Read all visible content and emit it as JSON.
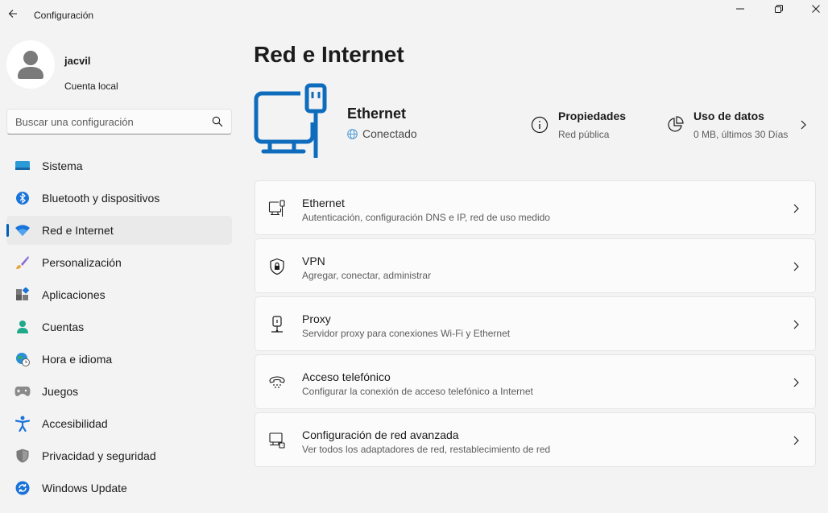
{
  "app": {
    "title": "Configuración"
  },
  "user": {
    "name": "jacvil",
    "account_type": "Cuenta local"
  },
  "search": {
    "placeholder": "Buscar una configuración"
  },
  "sidebar": {
    "items": [
      {
        "label": "Sistema",
        "icon": "system-icon"
      },
      {
        "label": "Bluetooth y dispositivos",
        "icon": "bluetooth-icon"
      },
      {
        "label": "Red e Internet",
        "icon": "wifi-icon",
        "active": true
      },
      {
        "label": "Personalización",
        "icon": "brush-icon"
      },
      {
        "label": "Aplicaciones",
        "icon": "apps-icon"
      },
      {
        "label": "Cuentas",
        "icon": "person-icon"
      },
      {
        "label": "Hora e idioma",
        "icon": "globe-clock-icon"
      },
      {
        "label": "Juegos",
        "icon": "gamepad-icon"
      },
      {
        "label": "Accesibilidad",
        "icon": "accessibility-icon"
      },
      {
        "label": "Privacidad y seguridad",
        "icon": "shield-icon"
      },
      {
        "label": "Windows Update",
        "icon": "update-icon"
      }
    ]
  },
  "main": {
    "title": "Red e Internet",
    "connection": {
      "name": "Ethernet",
      "status": "Conectado"
    },
    "properties": {
      "title": "Propiedades",
      "subtitle": "Red pública"
    },
    "data_usage": {
      "title": "Uso de datos",
      "subtitle": "0 MB, últimos 30 Días"
    },
    "cards": [
      {
        "title": "Ethernet",
        "subtitle": "Autenticación, configuración DNS e IP, red de uso medido",
        "icon": "ethernet-icon"
      },
      {
        "title": "VPN",
        "subtitle": "Agregar, conectar, administrar",
        "icon": "vpn-shield-icon"
      },
      {
        "title": "Proxy",
        "subtitle": "Servidor proxy para conexiones Wi-Fi y Ethernet",
        "icon": "proxy-icon"
      },
      {
        "title": "Acceso telefónico",
        "subtitle": "Configurar la conexión de acceso telefónico a Internet",
        "icon": "dialup-icon"
      },
      {
        "title": "Configuración de red avanzada",
        "subtitle": "Ver todos los adaptadores de red, restablecimiento de red",
        "icon": "network-adapter-icon"
      }
    ]
  },
  "colors": {
    "accent": "#005fb8",
    "hero_icon": "#0f6cbd",
    "background": "#f3f3f3",
    "card": "#fbfbfb"
  }
}
